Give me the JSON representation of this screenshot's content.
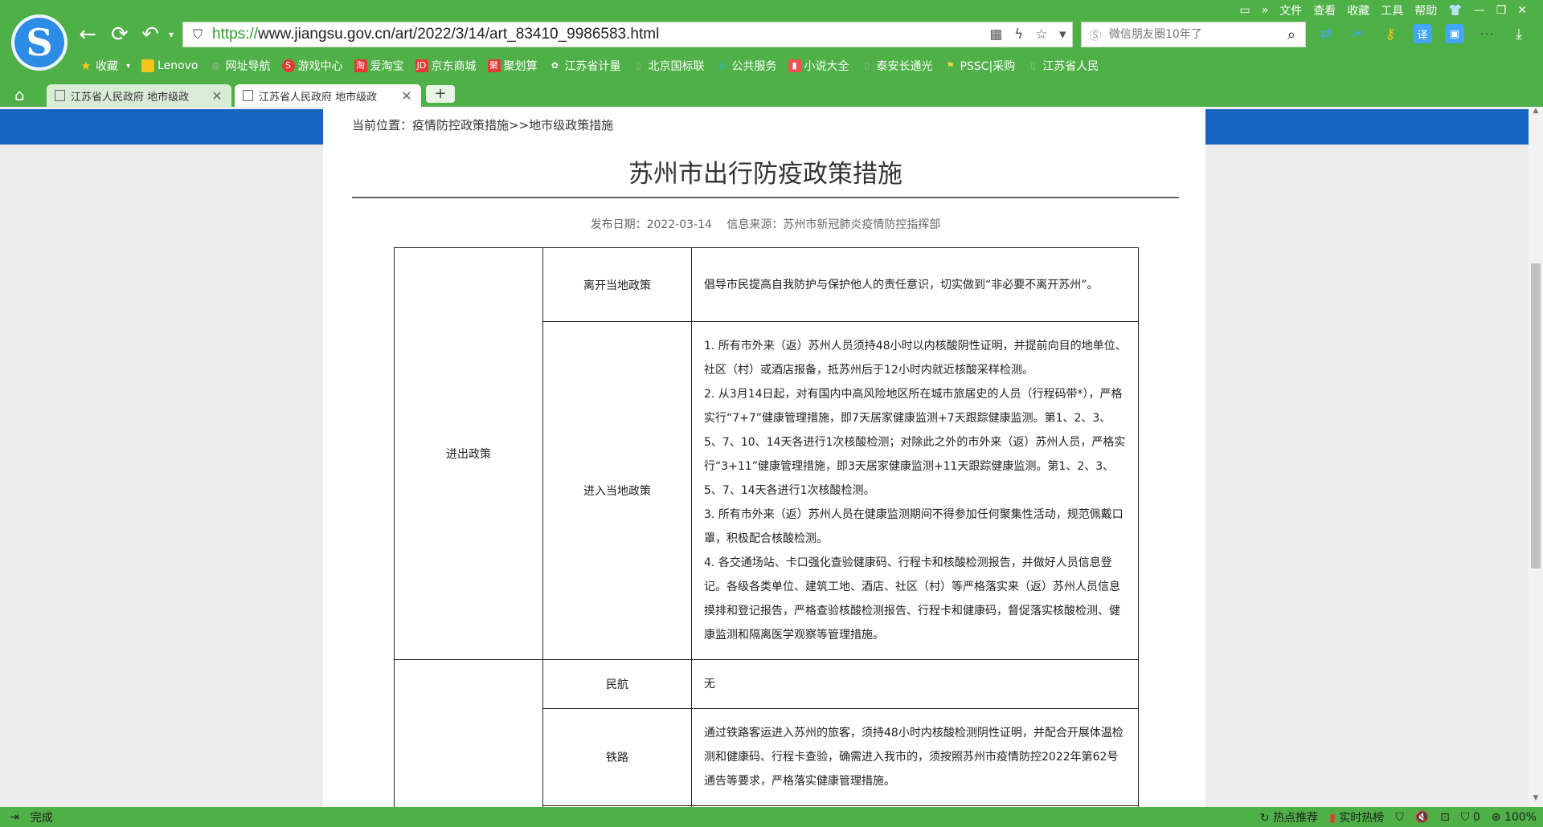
{
  "browser": {
    "menu": [
      "文件",
      "查看",
      "收藏",
      "工具",
      "帮助"
    ],
    "address": {
      "protocol": "https://",
      "host_path": "www.jiangsu.gov.cn/art/2022/3/14/art_83410_9986583.html"
    },
    "search_placeholder": "微信朋友圈10年了",
    "bookmarks": [
      {
        "label": "收藏",
        "icon": "star-icon",
        "color": "#f5c518"
      },
      {
        "label": "Lenovo",
        "icon": "folder-icon",
        "color": "#f5c518"
      },
      {
        "label": "网址导航",
        "icon": "globe-icon",
        "color": "#7a9a7a"
      },
      {
        "label": "游戏中心",
        "icon": "game-icon",
        "color": "#e53935"
      },
      {
        "label": "爱淘宝",
        "icon": "taobao-icon",
        "color": "#e53935"
      },
      {
        "label": "京东商城",
        "icon": "jd-icon",
        "color": "#e53935"
      },
      {
        "label": "聚划算",
        "icon": "juhuasuan-icon",
        "color": "#e53935"
      },
      {
        "label": "江苏省计量",
        "icon": "flower-icon",
        "color": "#2e7d32"
      },
      {
        "label": "北京国标联",
        "icon": "page-icon",
        "color": "#7a9a7a"
      },
      {
        "label": "公共服务",
        "icon": "circle-icon",
        "color": "#29b6f6"
      },
      {
        "label": "小说大全",
        "icon": "book-icon",
        "color": "#ef5350"
      },
      {
        "label": "泰安长通光",
        "icon": "page-icon",
        "color": "#7a9a7a"
      },
      {
        "label": "PSSC|采购",
        "icon": "flag-icon",
        "color": "#fdd835"
      },
      {
        "label": "江苏省人民",
        "icon": "page-icon",
        "color": "#7a9a7a"
      }
    ],
    "tabs": [
      {
        "label": "江苏省人民政府 地市级政",
        "active": false
      },
      {
        "label": "江苏省人民政府 地市级政",
        "active": true
      }
    ],
    "status_left": "完成",
    "status_right": {
      "hot": "热点推荐",
      "realtime": "实时热榜",
      "blocked": "0",
      "zoom": "100%"
    }
  },
  "page": {
    "breadcrumb_prefix": "当前位置：",
    "breadcrumb_1": "疫情防控政策措施",
    "breadcrumb_sep": ">>",
    "breadcrumb_2": "地市级政策措施",
    "title": "苏州市出行防疫政策措施",
    "publish_date_label": "发布日期：2022-03-14",
    "source_label": "信息来源：苏州市新冠肺炎疫情防控指挥部",
    "table": {
      "cat_1": "进出政策",
      "leave_label": "离开当地政策",
      "leave_text": "倡导市民提高自我防护与保护他人的责任意识，切实做到“非必要不离开苏州”。",
      "enter_label": "进入当地政策",
      "enter_items": [
        "1. 所有市外来（返）苏州人员须持48小时以内核酸阴性证明，并提前向目的地单位、社区（村）或酒店报备，抵苏州后于12小时内就近核酸采样检测。",
        "2. 从3月14日起，对有国内中高风险地区所在城市旅居史的人员（行程码带*），严格实行“7+7”健康管理措施，即7天居家健康监测+7天跟踪健康监测。第1、2、3、5、7、10、14天各进行1次核酸检测；对除此之外的市外来（返）苏州人员，严格实行“3+11”健康管理措施，即3天居家健康监测+11天跟踪健康监测。第1、2、3、5、7、14天各进行1次核酸检测。",
        "3. 所有市外来（返）苏州人员在健康监测期间不得参加任何聚集性活动，规范佩戴口罩，积极配合核酸检测。",
        "4. 各交通场站、卡口强化查验健康码、行程卡和核酸检测报告，并做好人员信息登记。各级各类单位、建筑工地、酒店、社区（村）等严格落实来（返）苏州人员信息摸排和登记报告，严格查验核酸检测报告、行程卡和健康码，督促落实核酸检测、健康监测和隔离医学观察等管理措施。"
      ],
      "aviation_label": "民航",
      "aviation_text": "无",
      "rail_label": "铁路",
      "rail_text": "通过铁路客运进入苏州的旅客，须持48小时内核酸检测阴性证明，并配合开展体温检测和健康码、行程卡查验，确需进入我市的，须按照苏州市疫情防控2022年第62号通告等要求，严格落实健康管理措施。"
    }
  }
}
